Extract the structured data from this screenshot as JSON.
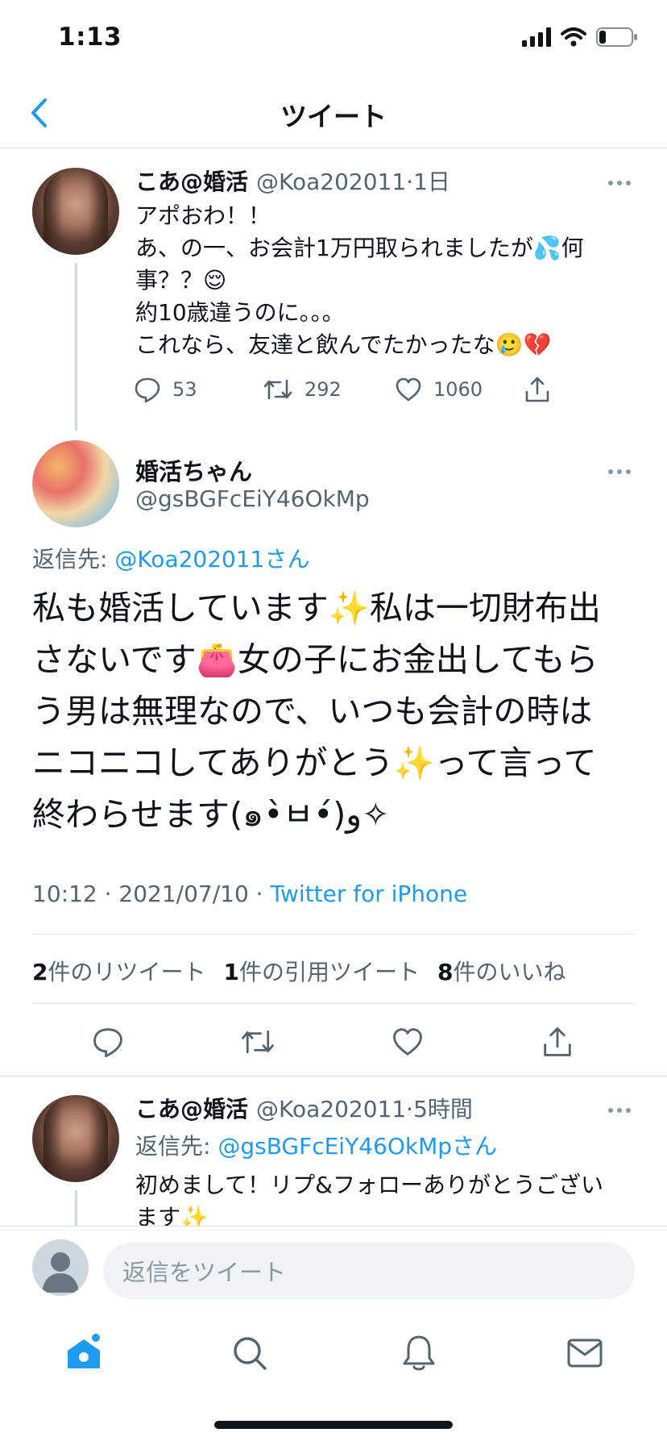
{
  "status_bar": {
    "time": "1:13"
  },
  "nav": {
    "title": "ツイート"
  },
  "tweet1": {
    "name": "こあ@婚活",
    "handle": "@Koa202011",
    "time": "·1日",
    "lines": [
      "アポおわ！！",
      "あ、の一、お会計1万円取られましたが💦何",
      "事？？😌",
      "約10歳違うのに。。。",
      "これなら、友達と飲んでたかったな🥲💔"
    ],
    "replies": "53",
    "retweets": "292",
    "likes": "1060"
  },
  "main_tweet": {
    "name": "婚活ちゃん",
    "handle": "@gsBGFcEiY46OkMp",
    "reply_prefix": "返信先: ",
    "reply_target": "@Koa202011さん",
    "lines": [
      "私も婚活しています✨私は一切財布出",
      "さないです👛女の子にお金出してもら",
      "う男は無理なので、いつも会計の時は",
      "ニコニコしてありがとう✨って言って",
      "終わらせます(๑•̀ㅂ•́)و✧"
    ],
    "timestamp": "10:12 · 2021/07/10 · ",
    "source": "Twitter for iPhone",
    "stats": {
      "retweets_count": "2",
      "retweets_label": "件のリツイート",
      "quotes_count": "1",
      "quotes_label": "件の引用ツイート",
      "likes_count": "8",
      "likes_label": "件のいいね"
    }
  },
  "tweet3": {
    "name": "こあ@婚活",
    "handle": "@Koa202011",
    "time": "·5時間",
    "reply_prefix": "返信先: ",
    "reply_target": "@gsBGFcEiY46OkMpさん",
    "lines": [
      "初めまして！リプ&フォローありがとうござい",
      "ます✨"
    ]
  },
  "composer": {
    "placeholder": "返信をツイート"
  },
  "colors": {
    "accent": "#1d9bf0",
    "secondary_text": "#536471",
    "border": "#dcdfe3"
  },
  "icons": [
    "back-icon",
    "more-icon",
    "reply-icon",
    "retweet-icon",
    "like-icon",
    "share-icon",
    "home-icon",
    "search-icon",
    "notifications-icon",
    "messages-icon"
  ]
}
